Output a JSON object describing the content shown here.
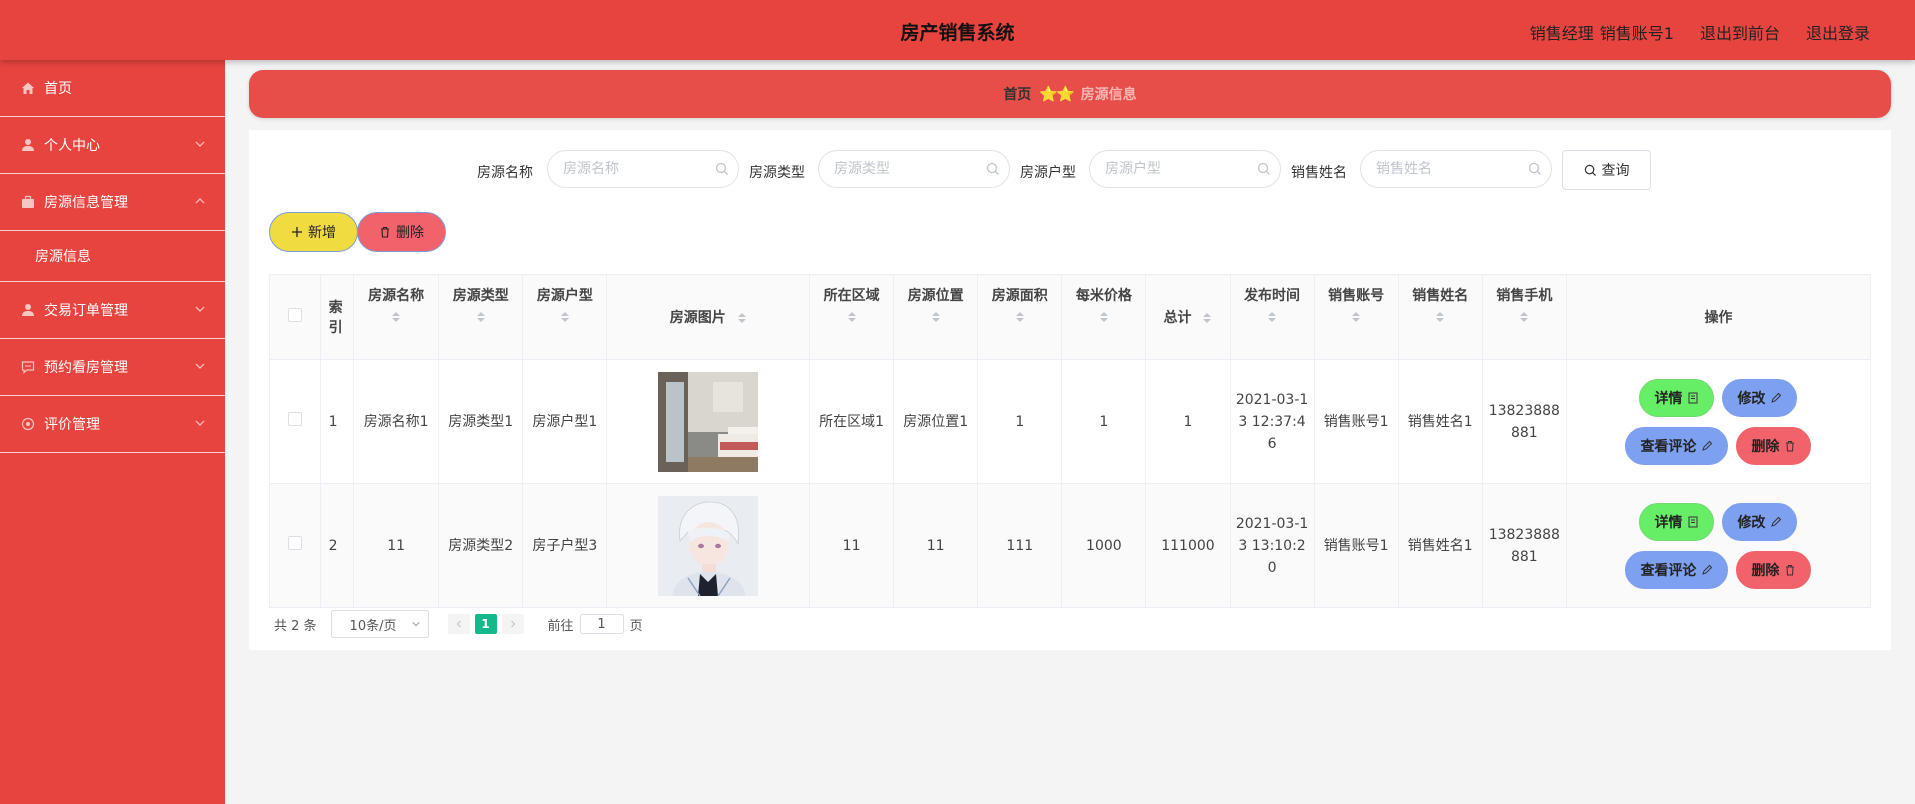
{
  "header": {
    "title": "房产销售系统",
    "role": "销售经理",
    "account": "销售账号1",
    "front_link": "退出到前台",
    "logout_link": "退出登录"
  },
  "sidebar": {
    "items": [
      {
        "label": "首页",
        "icon": "home-icon"
      },
      {
        "label": "个人中心",
        "icon": "user-icon"
      },
      {
        "label": "房源信息管理",
        "icon": "briefcase-icon",
        "expanded": true,
        "children": [
          "房源信息"
        ]
      },
      {
        "label": "交易订单管理",
        "icon": "user-icon"
      },
      {
        "label": "预约看房管理",
        "icon": "chat-icon"
      },
      {
        "label": "评价管理",
        "icon": "target-icon"
      }
    ]
  },
  "breadcrumb": {
    "home": "首页",
    "separator": "⭐⭐",
    "current": "房源信息"
  },
  "search": {
    "fields": [
      {
        "label": "房源名称",
        "placeholder": "房源名称"
      },
      {
        "label": "房源类型",
        "placeholder": "房源类型"
      },
      {
        "label": "房源户型",
        "placeholder": "房源户型"
      },
      {
        "label": "销售姓名",
        "placeholder": "销售姓名"
      }
    ],
    "query_label": "查询"
  },
  "actions": {
    "add_label": "新增",
    "delete_label": "删除"
  },
  "table": {
    "columns": [
      "索引",
      "房源名称",
      "房源类型",
      "房源户型",
      "房源图片",
      "所在区域",
      "房源位置",
      "房源面积",
      "每米价格",
      "总计",
      "发布时间",
      "销售账号",
      "销售姓名",
      "销售手机",
      "操作"
    ],
    "rows": [
      {
        "index": "1",
        "name": "房源名称1",
        "type": "房源类型1",
        "layout": "房源户型1",
        "image": "bedroom-photo",
        "area": "所在区域1",
        "location": "房源位置1",
        "size": "1",
        "price_per_m": "1",
        "total": "1",
        "publish_time": "2021-03-13 12:37:46",
        "sales_account": "销售账号1",
        "sales_name": "销售姓名1",
        "sales_phone": "13823888881"
      },
      {
        "index": "2",
        "name": "11",
        "type": "房源类型2",
        "layout": "房子户型3",
        "image": "anime-portrait",
        "area": "11",
        "location": "11",
        "size": "111",
        "price_per_m": "1000",
        "total": "111000",
        "publish_time": "2021-03-13 13:10:20",
        "sales_account": "销售账号1",
        "sales_name": "销售姓名1",
        "sales_phone": "13823888881"
      }
    ],
    "ops": {
      "detail": "详情",
      "edit": "修改",
      "comments": "查看评论",
      "delete": "删除"
    }
  },
  "pagination": {
    "total_text": "共 2 条",
    "page_size": "10条/页",
    "current_page": "1",
    "goto_prefix": "前往",
    "goto_value": "1",
    "goto_suffix": "页"
  },
  "colors": {
    "brand": "#e74440",
    "accent_green": "#13b98b"
  }
}
